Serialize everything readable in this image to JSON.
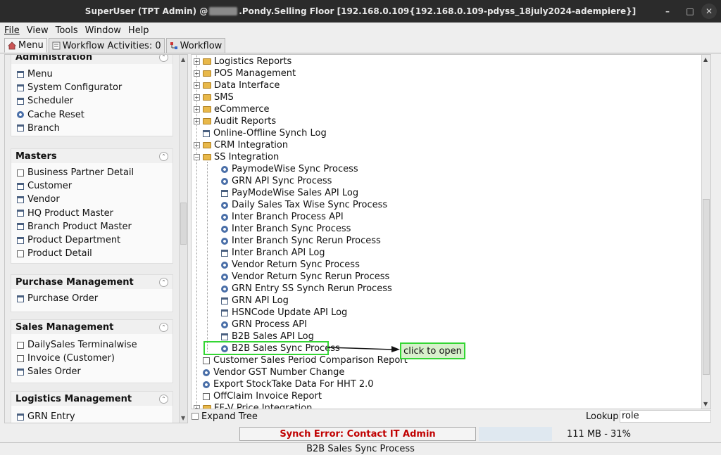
{
  "window": {
    "title_prefix": "SuperUser (TPT Admin) @",
    "title_suffix": ".Pondy.Selling Floor [192.168.0.109{192.168.0.109-pdyss_18july2024-adempiere}]",
    "min": "–",
    "max": "□",
    "close": "✕"
  },
  "menubar": [
    "File",
    "View",
    "Tools",
    "Window",
    "Help"
  ],
  "tabs": {
    "menu": "Menu",
    "activities": "Workflow Activities: 0",
    "workflow": "Workflow"
  },
  "left_panels": [
    {
      "title": "Administration",
      "items": [
        {
          "label": "Menu",
          "icon": "window"
        },
        {
          "label": "System Configurator",
          "icon": "window"
        },
        {
          "label": "Scheduler",
          "icon": "window"
        },
        {
          "label": "Cache Reset",
          "icon": "gear"
        },
        {
          "label": "Branch",
          "icon": "window"
        }
      ]
    },
    {
      "title": "Masters",
      "items": [
        {
          "label": "Business Partner Detail",
          "icon": "doc"
        },
        {
          "label": "Customer",
          "icon": "window"
        },
        {
          "label": "Vendor",
          "icon": "window"
        },
        {
          "label": "HQ Product Master",
          "icon": "window"
        },
        {
          "label": "Branch Product Master",
          "icon": "window"
        },
        {
          "label": "Product Department",
          "icon": "window"
        },
        {
          "label": "Product Detail",
          "icon": "doc"
        }
      ]
    },
    {
      "title": "Purchase Management",
      "items": [
        {
          "label": "Purchase Order",
          "icon": "window"
        }
      ]
    },
    {
      "title": "Sales Management",
      "items": [
        {
          "label": "DailySales Terminalwise",
          "icon": "doc"
        },
        {
          "label": "Invoice (Customer)",
          "icon": "doc"
        },
        {
          "label": "Sales Order",
          "icon": "window"
        }
      ]
    },
    {
      "title": "Logistics Management",
      "items": [
        {
          "label": "GRN Entry",
          "icon": "window"
        }
      ]
    }
  ],
  "tree": [
    {
      "label": "Logistics Reports",
      "type": "folder"
    },
    {
      "label": "POS Management",
      "type": "folder"
    },
    {
      "label": "Data Interface",
      "type": "folder"
    },
    {
      "label": "SMS",
      "type": "folder"
    },
    {
      "label": "eCommerce",
      "type": "folder"
    },
    {
      "label": "Audit Reports",
      "type": "folder"
    },
    {
      "label": "Online-Offline Synch Log",
      "type": "window"
    },
    {
      "label": "CRM Integration",
      "type": "folder"
    },
    {
      "label": "SS Integration",
      "type": "open-folder"
    },
    {
      "label": "PaymodeWise Sync Process",
      "type": "gear",
      "child": true
    },
    {
      "label": "GRN API Sync Process",
      "type": "gear",
      "child": true
    },
    {
      "label": "PayModeWise Sales API Log",
      "type": "window",
      "child": true
    },
    {
      "label": "Daily Sales Tax Wise Sync Process",
      "type": "gear",
      "child": true
    },
    {
      "label": "Inter Branch Process API",
      "type": "gear",
      "child": true
    },
    {
      "label": "Inter Branch Sync Process",
      "type": "gear",
      "child": true
    },
    {
      "label": "Inter Branch Sync Rerun Process",
      "type": "gear",
      "child": true
    },
    {
      "label": "Inter Branch API Log",
      "type": "window",
      "child": true
    },
    {
      "label": "Vendor Return Sync Process",
      "type": "gear",
      "child": true
    },
    {
      "label": "Vendor Return Sync Rerun Process",
      "type": "gear",
      "child": true
    },
    {
      "label": "GRN Entry SS Synch Rerun Process",
      "type": "gear",
      "child": true
    },
    {
      "label": "GRN API Log",
      "type": "window",
      "child": true
    },
    {
      "label": "HSNCode Update API Log",
      "type": "window",
      "child": true
    },
    {
      "label": "GRN Process API",
      "type": "gear",
      "child": true
    },
    {
      "label": "B2B Sales API Log",
      "type": "window",
      "child": true
    },
    {
      "label": "B2B Sales Sync Process",
      "type": "gear",
      "child": true,
      "highlight": true
    },
    {
      "label": "Customer Sales Period Comparison Report",
      "type": "doc"
    },
    {
      "label": "Vendor GST Number Change",
      "type": "gear"
    },
    {
      "label": "Export StockTake Data For HHT 2.0",
      "type": "gear"
    },
    {
      "label": "OffClaim Invoice Report",
      "type": "doc"
    },
    {
      "label": "FF-V Price Integration",
      "type": "folder"
    }
  ],
  "callout": "click to open",
  "expand_tree": "Expand Tree",
  "lookup": {
    "label": "Lookup",
    "value": "role"
  },
  "status": {
    "error": "Synch Error: Contact IT Admin",
    "memory": "111 MB - 31%"
  },
  "footer": "B2B Sales Sync Process"
}
